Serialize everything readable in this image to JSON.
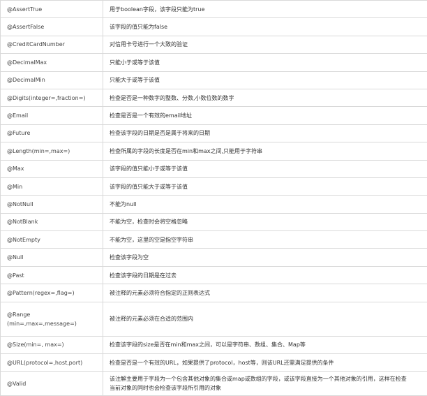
{
  "rows": [
    {
      "annotation": "@AssertTrue",
      "description": "用于boolean字段，该字段只能为true"
    },
    {
      "annotation": "@AssertFalse",
      "description": "该字段的值只能为false"
    },
    {
      "annotation": "@CreditCardNumber",
      "description": "对信用卡号进行一个大致的验证"
    },
    {
      "annotation": "@DecimalMax",
      "description": "只能小于或等于该值"
    },
    {
      "annotation": "@DecimalMin",
      "description": "只能大于或等于该值"
    },
    {
      "annotation": "@Digits(integer=,fraction=)",
      "description": "检查是否是一种数字的整数、分数,小数位数的数字"
    },
    {
      "annotation": "@Email",
      "description": "检查是否是一个有效的email地址"
    },
    {
      "annotation": "@Future",
      "description": "检查该字段的日期是否是属于将来的日期"
    },
    {
      "annotation": "@Length(min=,max=)",
      "description": "检查所属的字段的长度是否在min和max之间,只能用于字符串"
    },
    {
      "annotation": "@Max",
      "description": "该字段的值只能小于或等于该值"
    },
    {
      "annotation": "@Min",
      "description": "该字段的值只能大于或等于该值"
    },
    {
      "annotation": "@NotNull",
      "description": "不能为null"
    },
    {
      "annotation": "@NotBlank",
      "description": "不能为空，检查时会将空格忽略"
    },
    {
      "annotation": "@NotEmpty",
      "description": "不能为空，这里的空是指空字符串"
    },
    {
      "annotation": "@Null",
      "description": "检查该字段为空"
    },
    {
      "annotation": "@Past",
      "description": "检查该字段的日期是在过去"
    },
    {
      "annotation": "@Pattern(regex=,flag=)",
      "description": "被注释的元素必须符合指定的正则表达式"
    },
    {
      "annotation_line1": "@Range",
      "annotation_line2": "(min=,max=,message=)",
      "description": "被注释的元素必须在合适的范围内"
    },
    {
      "annotation": "@Size(min=, max=)",
      "description": "检查该字段的size是否在min和max之间，可以是字符串、数组、集合、Map等"
    },
    {
      "annotation": "@URL(protocol=,host,port)",
      "description": "检查是否是一个有效的URL，如果提供了protocol，host等，则该URL还需满足提供的条件"
    },
    {
      "annotation": "@Valid",
      "description_line1": "该注解主要用于字段为一个包含其他对象的集合或map或数组的字段，或该字段直接为一个其他对象的引用，这样在检查",
      "description_line2": "当前对象的同时也会检查该字段所引用的对象"
    }
  ]
}
